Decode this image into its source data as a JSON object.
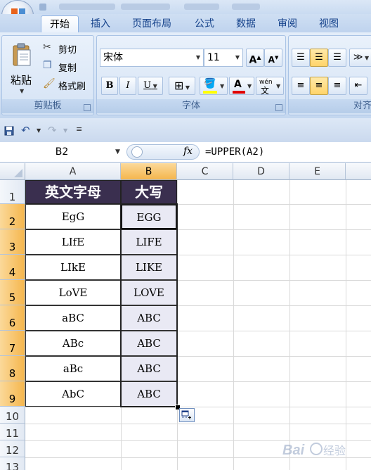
{
  "ribbon": {
    "tabs": [
      "开始",
      "插入",
      "页面布局",
      "公式",
      "数据",
      "审阅",
      "视图"
    ],
    "active_tab": "开始",
    "clipboard": {
      "paste_label": "粘贴",
      "cut_label": "剪切",
      "copy_label": "复制",
      "format_painter_label": "格式刷",
      "group_label": "剪贴板"
    },
    "font": {
      "font_name": "宋体",
      "font_size": "11",
      "bold_label": "B",
      "italic_label": "I",
      "underline_label": "U",
      "font_color_letter": "A",
      "phonetic_label": "wén",
      "group_label": "字体"
    },
    "alignment": {
      "group_label": "对齐"
    }
  },
  "formula_bar": {
    "name_box": "B2",
    "fx_label": "fx",
    "formula": "=UPPER(A2)"
  },
  "sheet": {
    "columns": [
      "A",
      "B",
      "C",
      "D",
      "E"
    ],
    "rows": [
      "1",
      "2",
      "3",
      "4",
      "5",
      "6",
      "7",
      "8",
      "9",
      "10",
      "11",
      "12",
      "13"
    ],
    "header_row": [
      "英文字母",
      "大写"
    ],
    "data": [
      [
        "EgG",
        "EGG"
      ],
      [
        "LIfE",
        "LIFE"
      ],
      [
        "LIkE",
        "LIKE"
      ],
      [
        "LoVE",
        "LOVE"
      ],
      [
        "aBC",
        "ABC"
      ],
      [
        "ABc",
        "ABC"
      ],
      [
        "aBc",
        "ABC"
      ],
      [
        "AbC",
        "ABC"
      ]
    ]
  },
  "colors": {
    "header_fill": "#3a2f4f",
    "selection_header": "#f5b64d",
    "ribbon_blue": "#15428b"
  },
  "watermark": "Baidu 经验"
}
